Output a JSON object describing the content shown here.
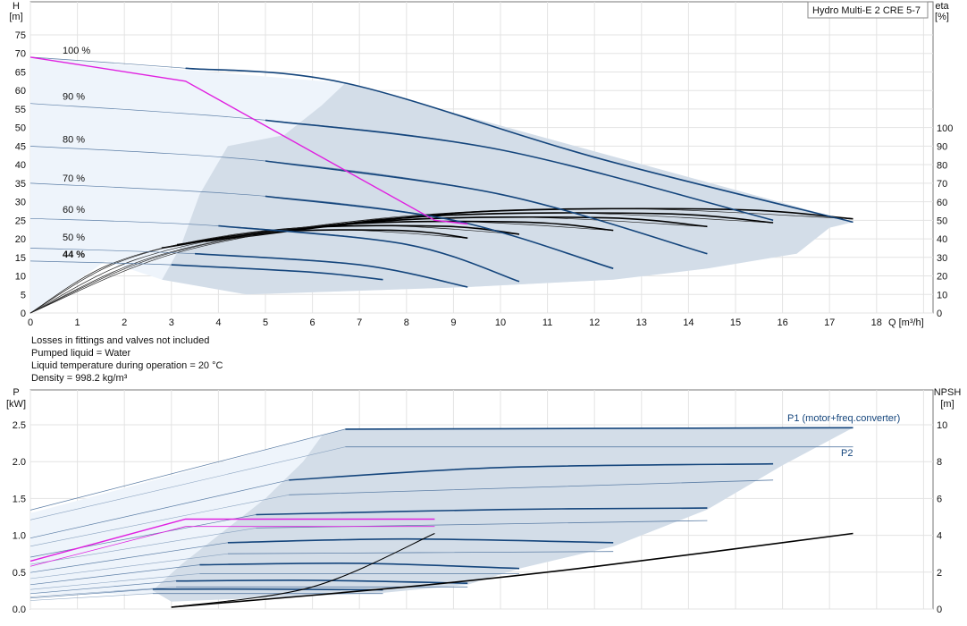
{
  "chart_data": [
    {
      "type": "line",
      "title": "Hydro Multi-E 2 CRE 5-7",
      "y_label_line1": "H",
      "y_label_line2": "[m]",
      "y2_label_line1": "eta",
      "y2_label_line2": "[%]",
      "x_label": "Q [m³/h]",
      "xlim": [
        0,
        18
      ],
      "ylim": [
        0,
        80
      ],
      "y2lim": [
        0,
        100
      ],
      "x_ticks": [
        0,
        1,
        2,
        3,
        4,
        5,
        6,
        7,
        8,
        9,
        10,
        11,
        12,
        13,
        14,
        15,
        16,
        17,
        18
      ],
      "y_ticks": [
        0,
        5,
        10,
        15,
        20,
        25,
        30,
        35,
        40,
        45,
        50,
        55,
        60,
        65,
        70,
        75
      ],
      "y2_ticks": [
        0,
        10,
        20,
        30,
        40,
        50,
        60,
        70,
        80,
        90,
        100
      ],
      "grid": true,
      "speed_labels": [
        {
          "text": "100 %",
          "h": 69.5
        },
        {
          "text": "90 %",
          "h": 57
        },
        {
          "text": "80 %",
          "h": 45.5
        },
        {
          "text": "70 %",
          "h": 35
        },
        {
          "text": "60 %",
          "h": 26.5
        },
        {
          "text": "50 %",
          "h": 19
        },
        {
          "text": "44 %",
          "h": 14.5
        }
      ],
      "speed_curves": [
        {
          "speed": 100,
          "h0": 69,
          "points": [
            [
              0,
              69
            ],
            [
              3.3,
              66
            ],
            [
              6.7,
              62
            ],
            [
              12,
              42
            ],
            [
              17.5,
              24.5
            ]
          ]
        },
        {
          "speed": 90,
          "h0": 56.5,
          "points": [
            [
              0,
              56.5
            ],
            [
              5,
              52
            ],
            [
              10,
              44
            ],
            [
              15.8,
              25
            ]
          ]
        },
        {
          "speed": 80,
          "h0": 45,
          "points": [
            [
              0,
              45
            ],
            [
              5,
              41
            ],
            [
              10,
              32
            ],
            [
              14.4,
              16
            ]
          ]
        },
        {
          "speed": 70,
          "h0": 35,
          "points": [
            [
              0,
              35
            ],
            [
              5,
              31.5
            ],
            [
              9,
              25
            ],
            [
              12.4,
              12
            ]
          ]
        },
        {
          "speed": 60,
          "h0": 25.5,
          "points": [
            [
              0,
              25.5
            ],
            [
              4,
              23.5
            ],
            [
              8,
              18.5
            ],
            [
              10.4,
              8.5
            ]
          ]
        },
        {
          "speed": 50,
          "h0": 17.5,
          "points": [
            [
              0,
              17.5
            ],
            [
              3.5,
              16
            ],
            [
              7,
              13
            ],
            [
              9.3,
              7
            ]
          ]
        },
        {
          "speed": 44,
          "h0": 14,
          "points": [
            [
              0,
              14
            ],
            [
              3,
              13
            ],
            [
              6,
              11
            ],
            [
              7.5,
              9
            ]
          ]
        }
      ],
      "efficiency_curves_q_end": [
        9.3,
        10.4,
        12.4,
        14.4,
        15.8,
        17.5
      ],
      "efficiency_peak_percent": 57,
      "duty_path": [
        [
          0,
          69
        ],
        [
          3.3,
          62.5
        ],
        [
          8.6,
          25
        ],
        [
          9.3,
          24
        ]
      ],
      "annotations": [
        "Losses in fittings and valves not included",
        "Pumped liquid = Water",
        "Liquid temperature during operation = 20 °C",
        "Density = 998.2 kg/m³"
      ]
    },
    {
      "type": "line",
      "y_label_line1": "P",
      "y_label_line2": "[kW]",
      "y2_label_line1": "NPSH",
      "y2_label_line2": "[m]",
      "xlim": [
        0,
        18
      ],
      "ylim": [
        0,
        2.7
      ],
      "y2lim": [
        0,
        11
      ],
      "y_ticks": [
        0.0,
        0.5,
        1.0,
        1.5,
        2.0,
        2.5
      ],
      "y_tick_labels": [
        "0.0",
        "0.5",
        "1.0",
        "1.5",
        "2.0",
        "2.5"
      ],
      "y2_ticks": [
        0,
        2,
        4,
        6,
        8,
        10
      ],
      "grid": true,
      "series": [
        {
          "name": "P1 (motor+freq.converter)",
          "values_kw": [
            [
              0,
              1.3
            ],
            [
              3,
              1.7
            ],
            [
              6.7,
              2.44
            ],
            [
              17.5,
              2.46
            ]
          ]
        },
        {
          "name": "P2",
          "values_kw": [
            [
              0,
              1.15
            ],
            [
              3,
              1.5
            ],
            [
              6.7,
              2.2
            ],
            [
              17.5,
              2.2
            ]
          ]
        }
      ],
      "power_curves": [
        {
          "speed": 100,
          "p1": [
            [
              6.7,
              2.44
            ],
            [
              12,
              2.45
            ],
            [
              17.5,
              2.46
            ]
          ],
          "p2": [
            [
              6.7,
              2.2
            ],
            [
              17.5,
              2.2
            ]
          ]
        },
        {
          "speed": 90,
          "p1": [
            [
              5.5,
              1.75
            ],
            [
              10,
              1.92
            ],
            [
              15.8,
              1.97
            ]
          ],
          "p2": [
            [
              5.5,
              1.55
            ],
            [
              15.8,
              1.75
            ]
          ]
        },
        {
          "speed": 80,
          "p1": [
            [
              4.8,
              1.28
            ],
            [
              10,
              1.35
            ],
            [
              14.4,
              1.37
            ]
          ],
          "p2": [
            [
              4.8,
              1.1
            ],
            [
              14.4,
              1.2
            ]
          ]
        },
        {
          "speed": 70,
          "p1": [
            [
              4.2,
              0.9
            ],
            [
              8,
              0.95
            ],
            [
              12.4,
              0.9
            ]
          ],
          "p2": [
            [
              4.2,
              0.75
            ],
            [
              12.4,
              0.78
            ]
          ]
        },
        {
          "speed": 60,
          "p1": [
            [
              3.6,
              0.6
            ],
            [
              7,
              0.62
            ],
            [
              10.4,
              0.55
            ]
          ],
          "p2": [
            [
              3.6,
              0.48
            ],
            [
              10.4,
              0.48
            ]
          ]
        },
        {
          "speed": 50,
          "p1": [
            [
              3.1,
              0.38
            ],
            [
              6,
              0.39
            ],
            [
              9.3,
              0.35
            ]
          ],
          "p2": [
            [
              3.1,
              0.3
            ],
            [
              9.3,
              0.3
            ]
          ]
        },
        {
          "speed": 44,
          "p1": [
            [
              2.6,
              0.27
            ],
            [
              5,
              0.27
            ],
            [
              7.5,
              0.26
            ]
          ],
          "p2": [
            [
              2.6,
              0.21
            ],
            [
              7.5,
              0.21
            ]
          ]
        }
      ],
      "duty_power": {
        "p1_kw": 1.22,
        "p2_kw": 1.12,
        "q_range": [
          3.3,
          8.6
        ]
      },
      "npsh_curve_m": [
        [
          3,
          0.1
        ],
        [
          8,
          1.2
        ],
        [
          12,
          2.3
        ],
        [
          17.5,
          4.1
        ]
      ],
      "npsh_small_curve_m": [
        [
          3,
          0.1
        ],
        [
          6,
          1.2
        ],
        [
          8.6,
          4.1
        ]
      ]
    }
  ]
}
